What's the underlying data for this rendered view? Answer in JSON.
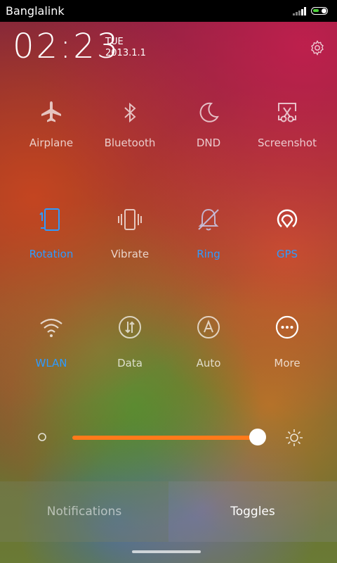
{
  "status_bar": {
    "carrier": "Banglalink",
    "battery_color": "#4cd138"
  },
  "header": {
    "time": "02:23",
    "day": "TUE",
    "date": "2013.1.1"
  },
  "toggles": [
    {
      "label": "Airplane",
      "icon": "airplane-icon",
      "active": false
    },
    {
      "label": "Bluetooth",
      "icon": "bluetooth-icon",
      "active": false
    },
    {
      "label": "DND",
      "icon": "moon-icon",
      "active": false
    },
    {
      "label": "Screenshot",
      "icon": "scissors-icon",
      "active": false
    },
    {
      "label": "Rotation",
      "icon": "rotation-icon",
      "active": true
    },
    {
      "label": "Vibrate",
      "icon": "vibrate-icon",
      "active": false
    },
    {
      "label": "Ring",
      "icon": "bell-muted-icon",
      "active": true
    },
    {
      "label": "GPS",
      "icon": "gps-icon",
      "active": true
    },
    {
      "label": "WLAN",
      "icon": "wifi-icon",
      "active": true
    },
    {
      "label": "Data",
      "icon": "data-icon",
      "active": false
    },
    {
      "label": "Auto",
      "icon": "auto-brightness-icon",
      "active": false
    },
    {
      "label": "More",
      "icon": "more-icon",
      "active": false
    }
  ],
  "brightness": {
    "level": 0.98,
    "track_color": "#ff7a1a"
  },
  "tabs": {
    "notifications": "Notifications",
    "toggles": "Toggles",
    "selected": "Toggles"
  },
  "colors": {
    "active": "#2e9bff"
  }
}
